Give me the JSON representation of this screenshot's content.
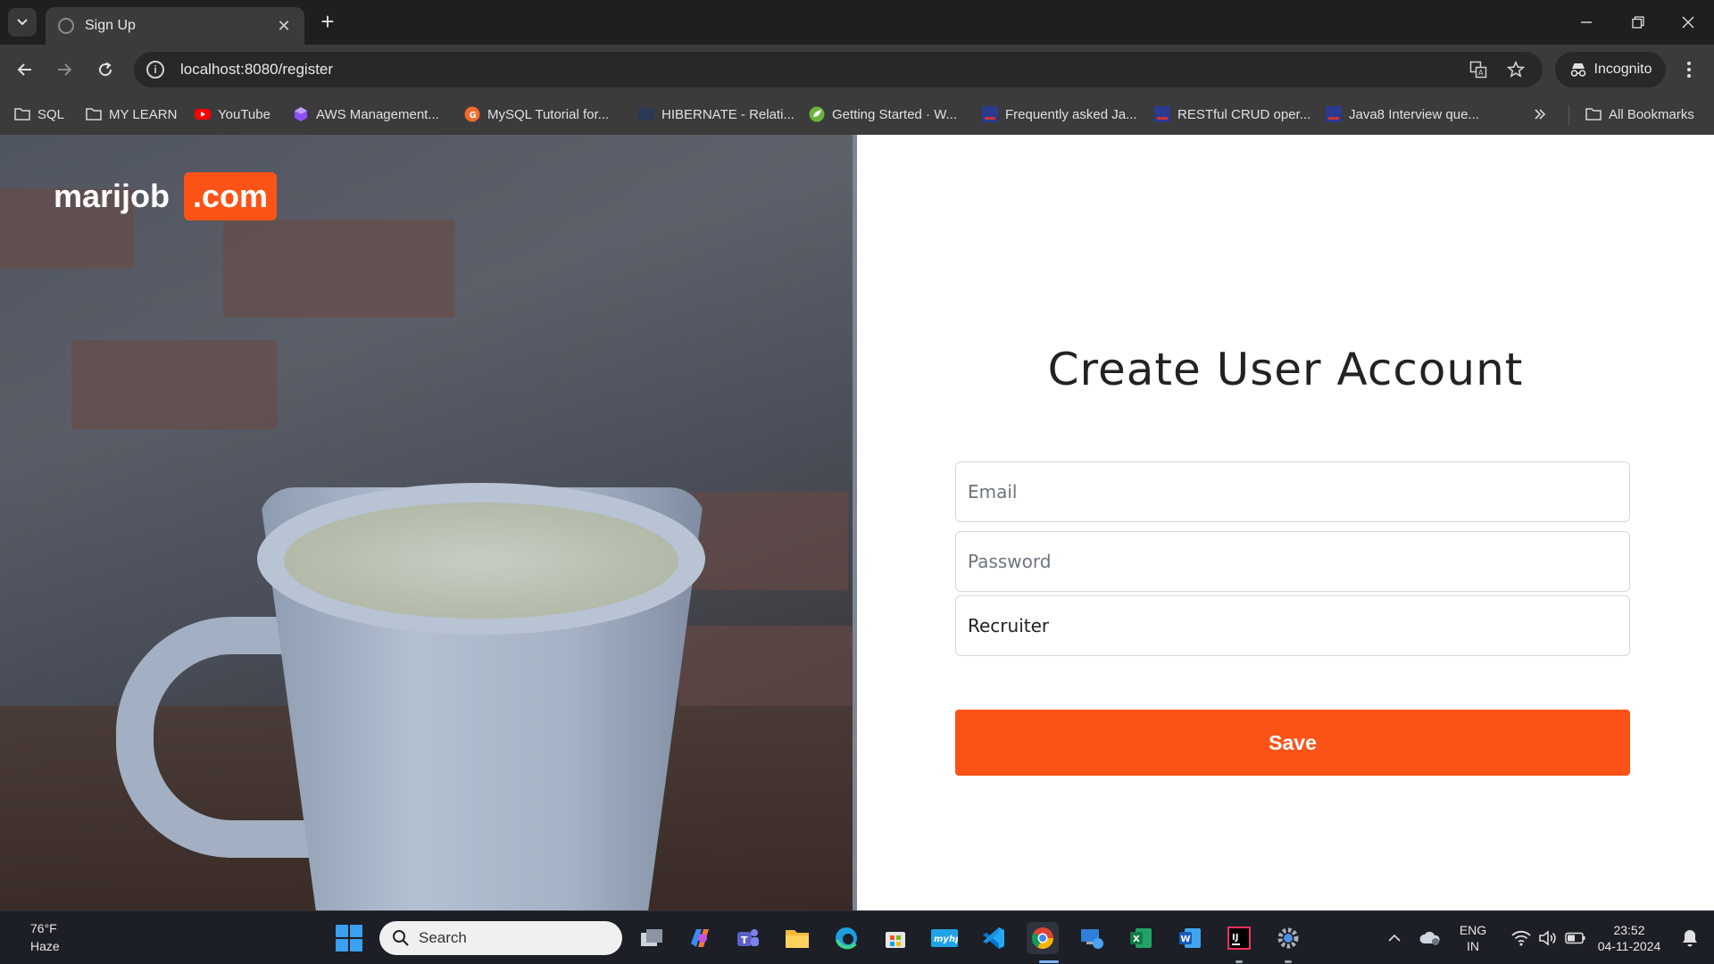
{
  "browser": {
    "tab_title": "Sign Up",
    "url": "localhost:8080/register",
    "profile_label": "Incognito",
    "bookmarks": [
      {
        "label": "SQL",
        "icon": "folder-icon"
      },
      {
        "label": "MY LEARN",
        "icon": "folder-icon"
      },
      {
        "label": "YouTube",
        "icon": "youtube-icon"
      },
      {
        "label": "AWS Management...",
        "icon": "aws-icon"
      },
      {
        "label": "MySQL Tutorial for...",
        "icon": "mysql-icon"
      },
      {
        "label": "HIBERNATE - Relati...",
        "icon": "site-icon"
      },
      {
        "label": "Getting Started · W...",
        "icon": "spring-icon"
      },
      {
        "label": "Frequently asked Ja...",
        "icon": "site-icon"
      },
      {
        "label": "RESTful CRUD oper...",
        "icon": "site-icon"
      },
      {
        "label": "Java8 Interview que...",
        "icon": "site-icon"
      }
    ],
    "all_bookmarks_label": "All Bookmarks"
  },
  "page": {
    "logo_text": "marijob",
    "logo_badge": ".com",
    "title": "Create User Account",
    "email_placeholder": "Email",
    "password_placeholder": "Password",
    "user_type_value": "Recruiter",
    "save_label": "Save",
    "colors": {
      "accent": "#fd5317"
    }
  },
  "taskbar": {
    "temperature": "76°F",
    "weather": "Haze",
    "search_label": "Search",
    "language_line1": "ENG",
    "language_line2": "IN",
    "time": "23:52",
    "date": "04-11-2024"
  }
}
